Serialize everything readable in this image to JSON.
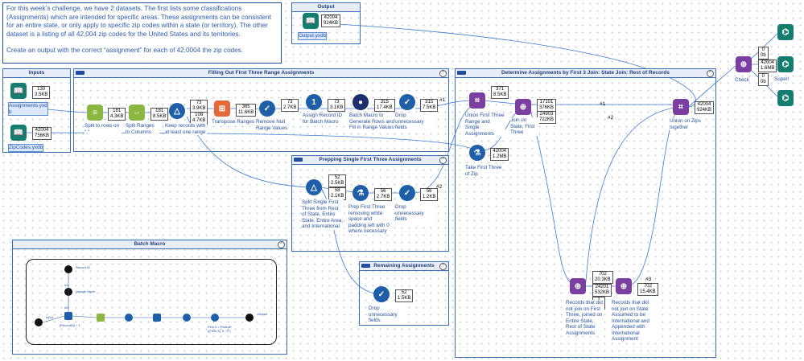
{
  "note": {
    "paragraph1": "For this week’s challenge, we have 2 datasets. The first lists some classifications (Assignments) which are intended for specific areas. These assignments can be consistent for an entire state, or only apply to specific zip codes within a state (or territory). The other dataset is a listing of all 42,004 zip codes for the United States and its territories.",
    "paragraph2": "Create an output with the correct “assignment” for each of 42,0004 the zip codes."
  },
  "containers": {
    "output": "Output",
    "inputs": "Inputs",
    "filling": "Filling Out First Three Range Assignments",
    "determine": "Determine Assignments by First 3 Join: State Join: Rest of Records",
    "prepping": "Prepping Single First Three Assignments",
    "remaining": "Remaining Assignments",
    "batch": "Batch Macro"
  },
  "tools": {
    "output_file": {
      "label": "Output.yxdb",
      "stat1": "42004",
      "stat2": "924KB"
    },
    "assignments": {
      "label": "Assignments.yxd b",
      "stat1": "130",
      "stat2": "3.5KB"
    },
    "zipcodes": {
      "label": "ZipCodes.yxdb",
      "stat1": "42004",
      "stat2": "756KB"
    },
    "split_rows": {
      "label": "Split to rows on \",\"",
      "stat1": "181",
      "stat2": "4.3KB"
    },
    "split_ranges": {
      "label": "Split Ranges to Columns",
      "stat1": "181",
      "stat2": "8.5KB"
    },
    "keep_records": {
      "label": "Keep records with at least one range",
      "t1": "73",
      "t2": "3.9KB",
      "f1": "108",
      "f2": "4.7KB"
    },
    "transpose": {
      "label": "Transpose Ranges",
      "stat1": "365",
      "stat2": "11.6KB"
    },
    "remove_null": {
      "label": "Remove Null Range Values",
      "stat1": "73",
      "stat2": "2.7KB"
    },
    "assign_id": {
      "label": "Assign Record ID for Batch Macro",
      "stat1": "73",
      "stat2": "3.1KB"
    },
    "batch_tool": {
      "label": "Batch Macro to Generate Rows and Fill in Range Values",
      "stat1": "315",
      "stat2": "17.4KB"
    },
    "drop1": {
      "label": "Drop unnecessary fields",
      "stat1": "315",
      "stat2": "7.5KB"
    },
    "union_first": {
      "label": "Union First Three Range and Single Assignments",
      "stat1": "371",
      "stat2": "8.5KB"
    },
    "join_state": {
      "label": "Join on State, First Three",
      "j1": "17101",
      "j2": "376KB",
      "r1": "24903",
      "r2": "722KB"
    },
    "take_first": {
      "label": "Take First Three of Zip",
      "stat1": "42004",
      "stat2": "1.2MB"
    },
    "union_zips": {
      "label": "Union on Zips together",
      "stat1": "42004",
      "stat2": "924KB"
    },
    "check": {
      "label": "Check",
      "l1": "0",
      "l2": "0b",
      "j1": "42004",
      "j2": "1.6MB",
      "r1": "0",
      "r2": "0b"
    },
    "super": {
      "label": "Super!"
    },
    "split_single": {
      "label": "Split Single First Three from Rest of State, Entire State, Entire Area, and International",
      "t1": "52",
      "t2": "2.5KB",
      "f1": "58",
      "f2": "2.1KB"
    },
    "prep_first": {
      "label": "Prep First Three removing white space and padding left with 0 where necessary",
      "stat1": "56",
      "stat2": "2.7KB"
    },
    "drop2": {
      "label": "Drop unnecessary fields",
      "stat1": "56",
      "stat2": "1.2KB"
    },
    "drop3": {
      "label": "Drop unnecessary fields",
      "stat1": "52",
      "stat2": "1.5KB"
    },
    "records_not_first": {
      "label": "Records that did not join on First Three, joined on Entire State, Rest of State Assignments",
      "l1": "702",
      "l2": "20.3KB",
      "j1": "24201",
      "j2": "532KB",
      "r1": "1",
      "r2": "44b"
    },
    "records_not_state": {
      "label": "Records that did not join on State Assumed to be International and Appended with International Assignment",
      "stat1": "702",
      "stat2": "15.4KB"
    }
  },
  "connections": {
    "c1": "#1",
    "c2": "#2",
    "c3": "#2",
    "c4": "#1",
    "c5": "#3"
  },
  "batch_macro": {
    "record_id": "Record ID",
    "update_value": "Update Value",
    "input": "Input",
    "formula": "[RecordID] + 1",
    "first3": "First 3 = PadLeft ([Field 3], 3, \"0\")",
    "output": "Output",
    "c_a": "#1",
    "c_b": "#2"
  }
}
